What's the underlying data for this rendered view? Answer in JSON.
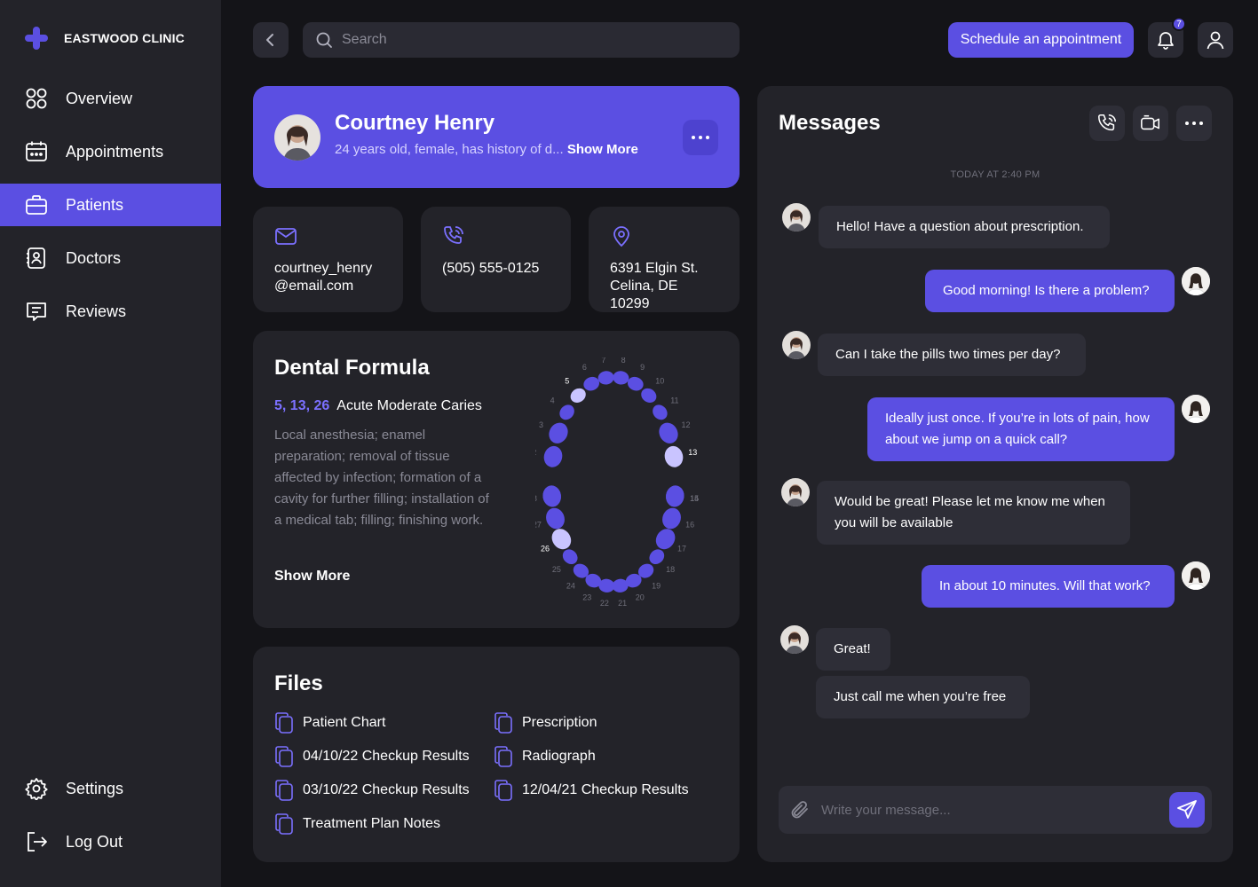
{
  "brand": {
    "name": "EASTWOOD CLINIC"
  },
  "nav": {
    "items": [
      {
        "label": "Overview",
        "icon": "grid-icon"
      },
      {
        "label": "Appointments",
        "icon": "calendar-icon"
      },
      {
        "label": "Patients",
        "icon": "briefcase-icon",
        "active": true
      },
      {
        "label": "Doctors",
        "icon": "id-card-icon"
      },
      {
        "label": "Reviews",
        "icon": "chat-lines-icon"
      }
    ],
    "settings": "Settings",
    "logout": "Log Out"
  },
  "topbar": {
    "search_placeholder": "Search",
    "schedule_label": "Schedule an appointment",
    "notification_count": "7"
  },
  "patient": {
    "name": "Courtney Henry",
    "description": "24 years old, female, has history of d...",
    "show_more": "Show More",
    "email_line1": "courtney_henry",
    "email_line2": "@email.com",
    "phone": "(505) 555-0125",
    "address_line1": "6391 Elgin St.",
    "address_line2": "Celina, DE 10299"
  },
  "dental": {
    "title": "Dental Formula",
    "teeth": "5, 13, 26",
    "diagnosis": "Acute Moderate Caries",
    "description": "Local anesthesia; enamel preparation; removal of tissue affected by infection; formation of a cavity for further filling; installation of a medical tab; filling; finishing work.",
    "show_more": "Show More",
    "selected_teeth": [
      5,
      13,
      26
    ]
  },
  "files": {
    "title": "Files",
    "items": [
      "Patient Chart",
      "04/10/22 Checkup Results",
      "03/10/22 Checkup Results",
      "Treatment Plan Notes",
      "Prescription",
      "Radiograph",
      "12/04/21 Checkup Results"
    ]
  },
  "messages": {
    "title": "Messages",
    "timestamp": "TODAY AT 2:40 PM",
    "items": [
      {
        "from": "patient",
        "text": "Hello! Have a question about prescription."
      },
      {
        "from": "doctor",
        "text": "Good morning! Is there a problem?"
      },
      {
        "from": "patient",
        "text": "Can I take the pills two times per day?"
      },
      {
        "from": "doctor",
        "text": "Ideally just once. If you’re in lots of pain, how about we jump on a quick call?"
      },
      {
        "from": "patient",
        "text": "Would be great! Please let me know me when you will be available"
      },
      {
        "from": "doctor",
        "text": "In about 10 minutes. Will that work?"
      },
      {
        "from": "patient",
        "text": "Great!"
      },
      {
        "from": "patient",
        "text": "Just call me when you’re free"
      }
    ],
    "composer_placeholder": "Write your message..."
  },
  "colors": {
    "accent": "#5b4fe2",
    "background": "#141418",
    "panel": "#232329",
    "tooth": "#5b4fe2",
    "tooth_selected": "#c9c4ff"
  }
}
